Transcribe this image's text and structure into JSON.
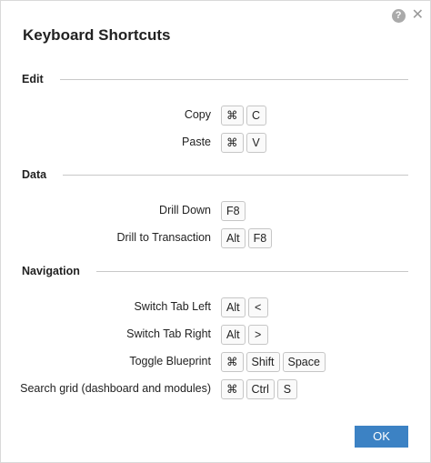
{
  "dialog": {
    "title": "Keyboard Shortcuts",
    "help_glyph": "?",
    "close_glyph": "✕",
    "ok_label": "OK",
    "accent_color": "#3c82c4"
  },
  "sections": [
    {
      "label": "Edit",
      "shortcuts": [
        {
          "action": "Copy",
          "keys": [
            "⌘",
            "C"
          ]
        },
        {
          "action": "Paste",
          "keys": [
            "⌘",
            "V"
          ]
        }
      ]
    },
    {
      "label": "Data",
      "shortcuts": [
        {
          "action": "Drill Down",
          "keys": [
            "F8"
          ]
        },
        {
          "action": "Drill to Transaction",
          "keys": [
            "Alt",
            "F8"
          ]
        }
      ]
    },
    {
      "label": "Navigation",
      "shortcuts": [
        {
          "action": "Switch Tab Left",
          "keys": [
            "Alt",
            "<"
          ]
        },
        {
          "action": "Switch Tab Right",
          "keys": [
            "Alt",
            ">"
          ]
        },
        {
          "action": "Toggle Blueprint",
          "keys": [
            "⌘",
            "Shift",
            "Space"
          ]
        },
        {
          "action": "Search grid (dashboard and modules)",
          "keys": [
            "⌘",
            "Ctrl",
            "S"
          ]
        }
      ]
    }
  ]
}
